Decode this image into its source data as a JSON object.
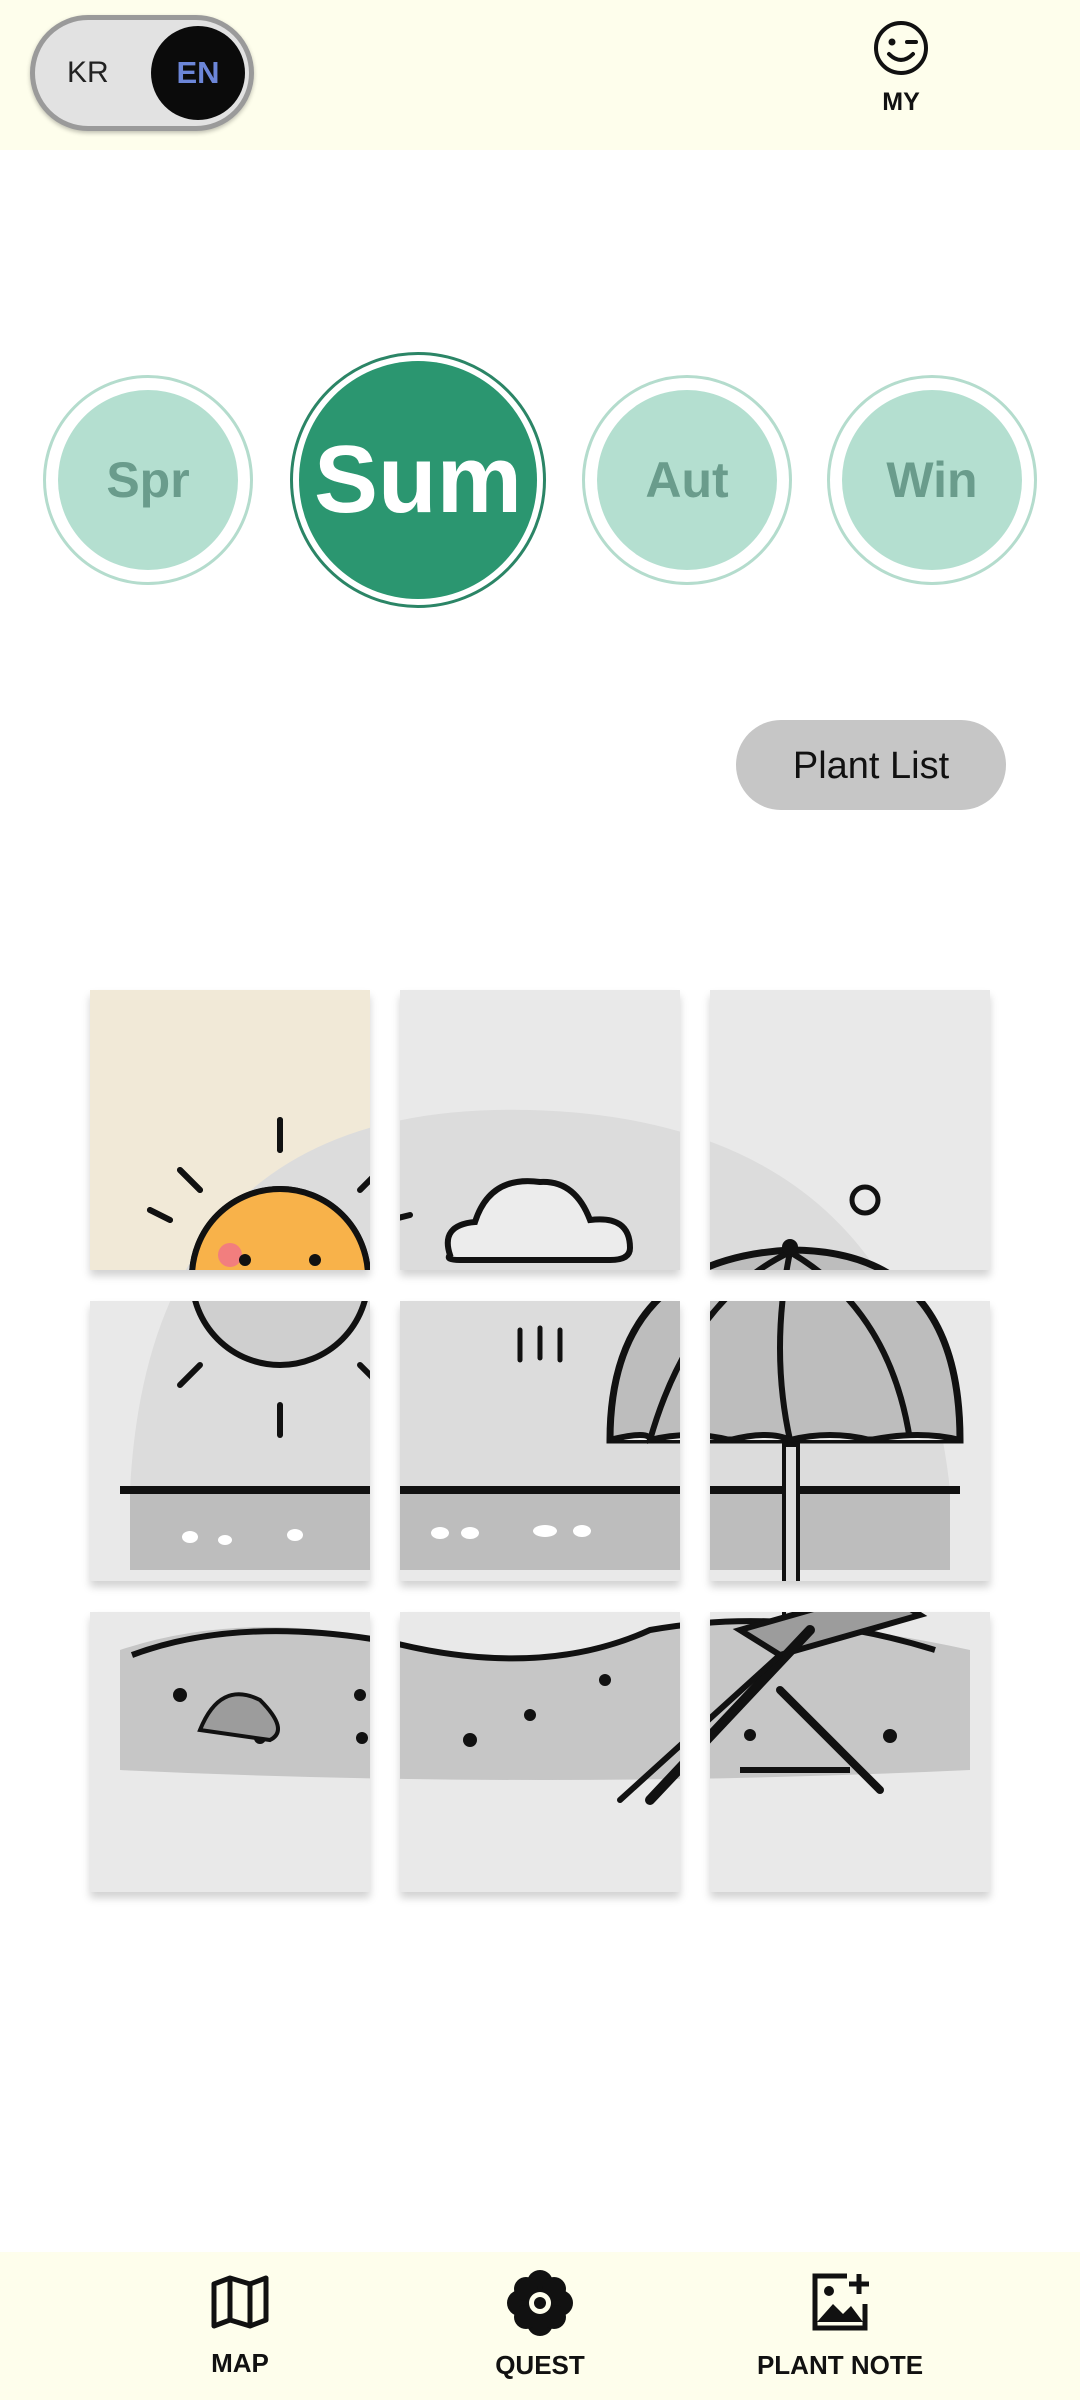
{
  "header": {
    "language": {
      "options": [
        "KR",
        "EN"
      ],
      "selected": "EN"
    },
    "my_label": "MY",
    "my_icon": "smiley-icon"
  },
  "seasons": [
    {
      "label": "Spr",
      "selected": false
    },
    {
      "label": "Sum",
      "selected": true
    },
    {
      "label": "Aut",
      "selected": false
    },
    {
      "label": "Win",
      "selected": false
    }
  ],
  "plant_list_button": "Plant List",
  "puzzle": {
    "rows": 3,
    "cols": 3,
    "revealed_tiles": [
      1
    ],
    "picture": "summer beach with sun, cloud, parasol and deck chair"
  },
  "nav": [
    {
      "label": "MAP",
      "icon": "map-icon"
    },
    {
      "label": "QUEST",
      "icon": "flower-icon"
    },
    {
      "label": "PLANT NOTE",
      "icon": "add-photo-icon"
    }
  ],
  "colors": {
    "bar_bg": "#fefeec",
    "season_active": "#2b9670",
    "season_inactive": "#b4dfd0",
    "season_inactive_text": "#6a9c8c",
    "lang_active_text": "#6c86d8"
  }
}
